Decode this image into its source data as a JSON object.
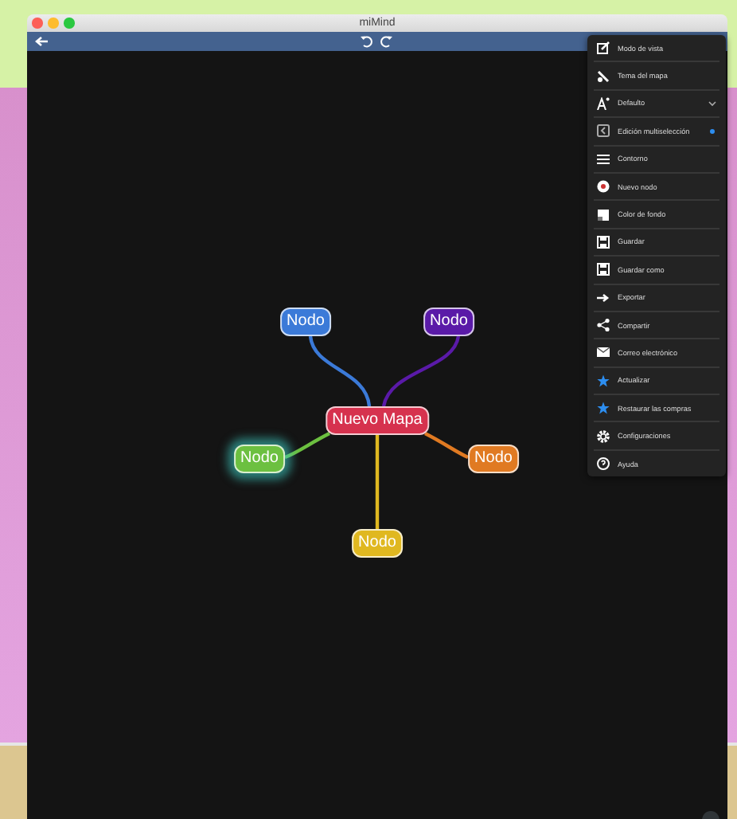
{
  "window": {
    "title": "miMind"
  },
  "menu": {
    "items": [
      {
        "label": "Modo de vista",
        "kind": "plain"
      },
      {
        "label": "Tema del mapa",
        "kind": "plain"
      },
      {
        "label": "Defaulto",
        "kind": "dropdown"
      },
      {
        "label": "Edición multiselección",
        "kind": "toggle",
        "on": true
      },
      {
        "label": "Contorno",
        "kind": "plain"
      },
      {
        "label": "Nuevo nodo",
        "kind": "plain"
      },
      {
        "label": "Color de fondo",
        "kind": "plain"
      },
      {
        "label": "Guardar",
        "kind": "plain"
      },
      {
        "label": "Guardar como",
        "kind": "plain"
      },
      {
        "label": "Exportar",
        "kind": "plain"
      },
      {
        "label": "Compartir",
        "kind": "plain"
      },
      {
        "label": "Correo electrónico",
        "kind": "plain"
      },
      {
        "label": "Actualizar",
        "kind": "plain"
      },
      {
        "label": "Restaurar las compras",
        "kind": "plain"
      },
      {
        "label": "Configuraciones",
        "kind": "plain"
      },
      {
        "label": "Ayuda",
        "kind": "plain"
      }
    ]
  },
  "map": {
    "root": {
      "text": "Nuevo Mapa",
      "color": "#d6324e"
    },
    "children": [
      {
        "text": "Nodo",
        "color": "#3b7ad8",
        "selected": false
      },
      {
        "text": "Nodo",
        "color": "#5a1aa8",
        "selected": false
      },
      {
        "text": "Nodo",
        "color": "#6cc040",
        "selected": true
      },
      {
        "text": "Nodo",
        "color": "#e07a22",
        "selected": false
      },
      {
        "text": "Nodo",
        "color": "#e0b820",
        "selected": false
      }
    ]
  }
}
